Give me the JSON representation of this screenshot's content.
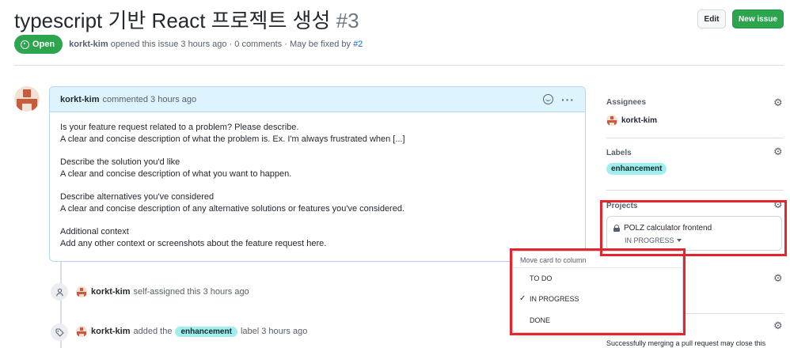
{
  "header": {
    "title": "typescript 기반 React 프로젝트 생성",
    "number": "#3",
    "edit_label": "Edit",
    "new_issue_label": "New issue"
  },
  "state": {
    "badge": "Open",
    "author": "korkt-kim",
    "meta_text": "opened this issue 3 hours ago · 0 comments · May be fixed by",
    "fix_link": "#2"
  },
  "comment": {
    "author": "korkt-kim",
    "time": "commented 3 hours ago",
    "sections": [
      {
        "heading": "Is your feature request related to a problem? Please describe.",
        "text": "A clear and concise description of what the problem is. Ex. I'm always frustrated when [...]"
      },
      {
        "heading": "Describe the solution you'd like",
        "text": "A clear and concise description of what you want to happen."
      },
      {
        "heading": "Describe alternatives you've considered",
        "text": "A clear and concise description of any alternative solutions or features you've considered."
      },
      {
        "heading": "Additional context",
        "text": "Add any other context or screenshots about the feature request here."
      }
    ]
  },
  "timeline": [
    {
      "icon": "person-icon",
      "author": "korkt-kim",
      "text": "self-assigned this 3 hours ago"
    },
    {
      "icon": "tag-icon",
      "author": "korkt-kim",
      "before": "added the",
      "label": "enhancement",
      "after": "label 3 hours ago"
    }
  ],
  "sidebar": {
    "assignees_heading": "Assignees",
    "assignee": "korkt-kim",
    "labels_heading": "Labels",
    "label": "enhancement",
    "projects_heading": "Projects",
    "project_name": "POLZ calculator frontend",
    "project_column": "IN PROGRESS",
    "merge_note": "Successfully merging a pull request may close this"
  },
  "move_menu": {
    "heading": "Move card to column",
    "options": [
      "TO DO",
      "IN PROGRESS",
      "DONE"
    ],
    "selected": "IN PROGRESS"
  },
  "colors": {
    "open_green": "#2da44e",
    "label_bg": "#a2eeef",
    "highlight_red": "#e3262d",
    "link_blue": "#0969da"
  }
}
